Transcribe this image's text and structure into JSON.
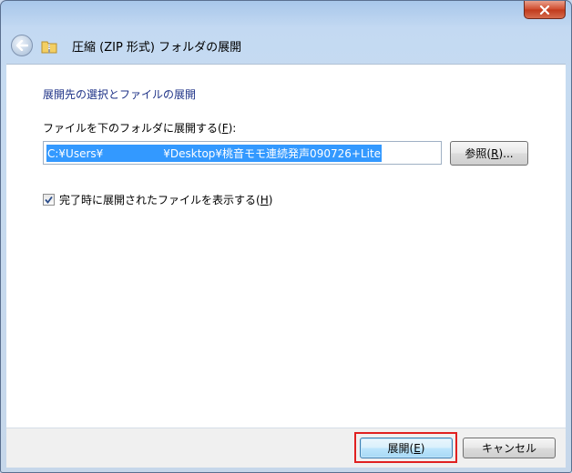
{
  "window": {
    "title": "圧縮 (ZIP 形式) フォルダの展開",
    "close_icon": "close-icon",
    "back_icon": "back-arrow-icon",
    "folder_icon": "zip-folder-icon"
  },
  "main": {
    "heading": "展開先の選択とファイルの展開",
    "destination_label_prefix": "ファイルを下のフォルダに展開する(",
    "destination_label_key": "F",
    "destination_label_suffix": "):",
    "destination_path_start": "C:¥Users¥",
    "destination_path_end": "¥Desktop¥桃音モモ連続発声090726+Lite",
    "browse_label_prefix": "参照(",
    "browse_label_key": "R",
    "browse_label_suffix": ")...",
    "show_files_checked": true,
    "show_files_label_prefix": "完了時に展開されたファイルを表示する(",
    "show_files_label_key": "H",
    "show_files_label_suffix": ")"
  },
  "footer": {
    "extract_label_prefix": "展開(",
    "extract_label_key": "E",
    "extract_label_suffix": ")",
    "cancel_label": "キャンセル",
    "highlight_color": "#e02020"
  }
}
